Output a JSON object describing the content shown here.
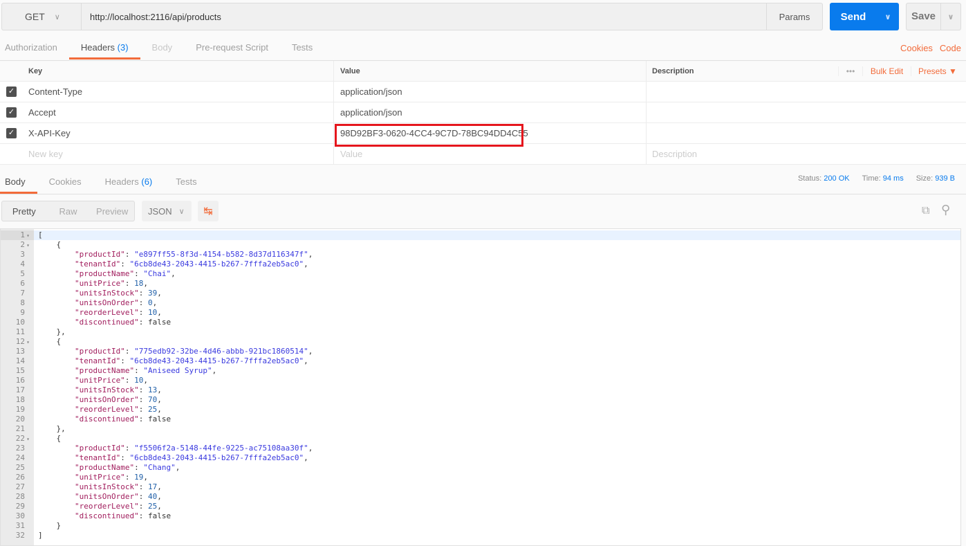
{
  "request": {
    "method": "GET",
    "url": "http://localhost:2116/api/products",
    "params_label": "Params",
    "send_label": "Send",
    "save_label": "Save"
  },
  "request_tabs": [
    {
      "label": "Authorization"
    },
    {
      "label": "Headers",
      "count": "(3)"
    },
    {
      "label": "Body"
    },
    {
      "label": "Pre-request Script"
    },
    {
      "label": "Tests"
    }
  ],
  "request_links": {
    "cookies": "Cookies",
    "code": "Code"
  },
  "headers_table": {
    "columns": {
      "key": "Key",
      "value": "Value",
      "description": "Description"
    },
    "actions": {
      "more": "•••",
      "bulk_edit": "Bulk Edit",
      "presets": "Presets"
    },
    "rows": [
      {
        "checked": true,
        "key": "Content-Type",
        "value": "application/json",
        "description": ""
      },
      {
        "checked": true,
        "key": "Accept",
        "value": "application/json",
        "description": ""
      },
      {
        "checked": true,
        "key": "X-API-Key",
        "value": "98D92BF3-0620-4CC4-9C7D-78BC94DD4C55",
        "description": ""
      }
    ],
    "placeholders": {
      "key": "New key",
      "value": "Value",
      "description": "Description"
    }
  },
  "response_tabs": [
    {
      "label": "Body"
    },
    {
      "label": "Cookies"
    },
    {
      "label": "Headers",
      "count": "(6)"
    },
    {
      "label": "Tests"
    }
  ],
  "stats": {
    "status_label": "Status:",
    "status": "200 OK",
    "time_label": "Time:",
    "time": "94 ms",
    "size_label": "Size:",
    "size": "939 B"
  },
  "view_modes": [
    "Pretty",
    "Raw",
    "Preview"
  ],
  "format": "JSON",
  "products": [
    {
      "productId": "e897ff55-8f3d-4154-b582-8d37d116347f",
      "tenantId": "6cb8de43-2043-4415-b267-7fffa2eb5ac0",
      "productName": "Chai",
      "unitPrice": 18,
      "unitsInStock": 39,
      "unitsOnOrder": 0,
      "reorderLevel": 10,
      "discontinued": false
    },
    {
      "productId": "775edb92-32be-4d46-abbb-921bc1860514",
      "tenantId": "6cb8de43-2043-4415-b267-7fffa2eb5ac0",
      "productName": "Aniseed Syrup",
      "unitPrice": 10,
      "unitsInStock": 13,
      "unitsOnOrder": 70,
      "reorderLevel": 25,
      "discontinued": false
    },
    {
      "productId": "f5506f2a-5148-44fe-9225-ac75108aa30f",
      "tenantId": "6cb8de43-2043-4415-b267-7fffa2eb5ac0",
      "productName": "Chang",
      "unitPrice": 19,
      "unitsInStock": 17,
      "unitsOnOrder": 40,
      "reorderLevel": 25,
      "discontinued": false
    }
  ]
}
